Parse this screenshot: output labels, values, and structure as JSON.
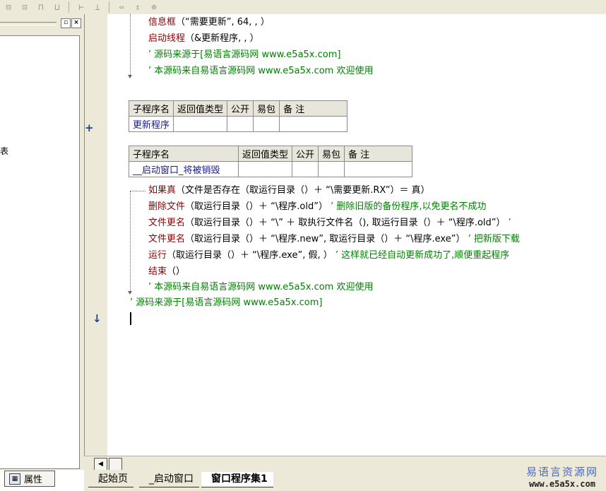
{
  "toolbar": {
    "icons": [
      "align-left-icon",
      "align-center-icon",
      "align-top-icon",
      "align-bottom-icon",
      "width-equal-icon",
      "height-equal-icon",
      "stretch-horizontal-icon",
      "stretch-vertical-icon",
      "center-icon"
    ]
  },
  "left_panel": {
    "partial_text": "表",
    "props_tab_label": "属性"
  },
  "code": {
    "top_lines": [
      {
        "kw": "信息框",
        "rest": "（“需要更新”, 64, , ）"
      },
      {
        "kw": "启动线程",
        "rest": "（&更新程序, , ）"
      }
    ],
    "comment1": "’ 源码来源于[易语言源码网 www.e5a5x.com]",
    "comment2": "’ 本源码来自易语言源码网 www.e5a5x.com  欢迎使用",
    "table1": {
      "headers": [
        "子程序名",
        "返回值类型",
        "公开",
        "易包",
        "备 注"
      ],
      "name": "更新程序"
    },
    "table2": {
      "headers": [
        "子程序名",
        "返回值类型",
        "公开",
        "易包",
        "备 注"
      ],
      "name": "__启动窗口_将被销毁"
    },
    "if_line": {
      "kw": "如果真",
      "rest": "（文件是否存在（取运行目录（）＋ “\\需要更新.RX”）＝ 真）"
    },
    "body_lines": [
      {
        "kw": "删除文件",
        "rest": "（取运行目录（）＋ “\\程序.old”）",
        "comment": "’ 删除旧版的备份程序,以免更名不成功"
      },
      {
        "kw": "文件更名",
        "rest": "（取运行目录（）＋ “\\” ＋ 取执行文件名（), 取运行目录（）＋ “\\程序.old”）",
        "comment": "’"
      },
      {
        "kw": "文件更名",
        "rest": "（取运行目录（）＋ “\\程序.new”, 取运行目录（）＋ “\\程序.exe”）",
        "comment": "’ 把新版下载"
      },
      {
        "kw": "运行",
        "rest": "（取运行目录（）＋ “\\程序.exe”, 假, ）",
        "comment": "’ 这样就已经自动更新成功了,顺便重起程序"
      },
      {
        "kw": "结束",
        "rest": "（）",
        "comment": ""
      }
    ],
    "comment3": "’ 本源码来自易语言源码网 www.e5a5x.com  欢迎使用",
    "comment4": "’ 源码来源于[易语言源码网 www.e5a5x.com]"
  },
  "tabs": [
    "起始页",
    "_启动窗口",
    "窗口程序集1"
  ],
  "logo": {
    "cn": "易语言资源网",
    "url": "www.e5a5x.com"
  },
  "gutter": {
    "plus": "+",
    "arrow": "↓"
  }
}
